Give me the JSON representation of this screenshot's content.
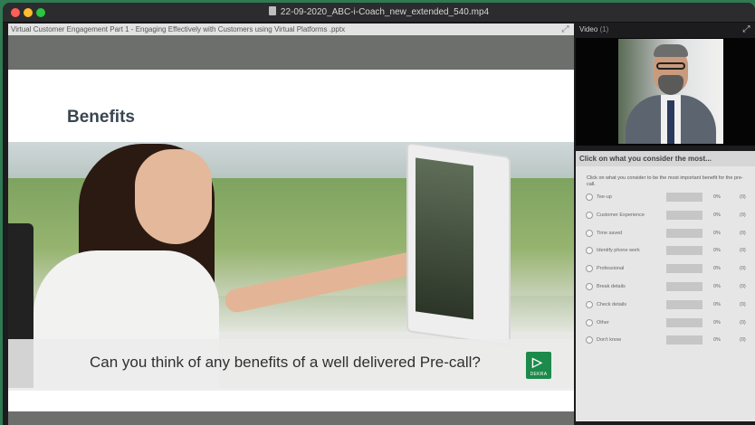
{
  "window": {
    "title": "22-09-2020_ABC-i-Coach_new_extended_540.mp4"
  },
  "presentation": {
    "file_title": "Virtual Customer Engagement Part 1 - Engaging Effectively with Customers using Virtual Platforms .pptx",
    "slide_title": "Benefits",
    "caption": "Can you think of any benefits of a well delivered Pre-call?",
    "logo_text": "DEKRA"
  },
  "video": {
    "label": "Video",
    "count": "(1)"
  },
  "poll": {
    "header": "Click on what you consider the most...",
    "question": "Click on what you consider to be the most important benefit for the pre-call.",
    "options": [
      {
        "label": "Tee-up",
        "percent": 0,
        "percent_text": "0%",
        "count": "(0)"
      },
      {
        "label": "Customer Experience",
        "percent": 0,
        "percent_text": "0%",
        "count": "(0)"
      },
      {
        "label": "Time saved",
        "percent": 0,
        "percent_text": "0%",
        "count": "(0)"
      },
      {
        "label": "Identify phone work",
        "percent": 0,
        "percent_text": "0%",
        "count": "(0)"
      },
      {
        "label": "Professional",
        "percent": 0,
        "percent_text": "0%",
        "count": "(0)"
      },
      {
        "label": "Break details",
        "percent": 0,
        "percent_text": "0%",
        "count": "(0)"
      },
      {
        "label": "Check details",
        "percent": 0,
        "percent_text": "0%",
        "count": "(0)"
      },
      {
        "label": "Other",
        "percent": 0,
        "percent_text": "0%",
        "count": "(0)"
      },
      {
        "label": "Don't know",
        "percent": 0,
        "percent_text": "0%",
        "count": "(0)"
      }
    ]
  },
  "colors": {
    "desktop": "#2f7a52",
    "logo": "#1c8a4a"
  }
}
